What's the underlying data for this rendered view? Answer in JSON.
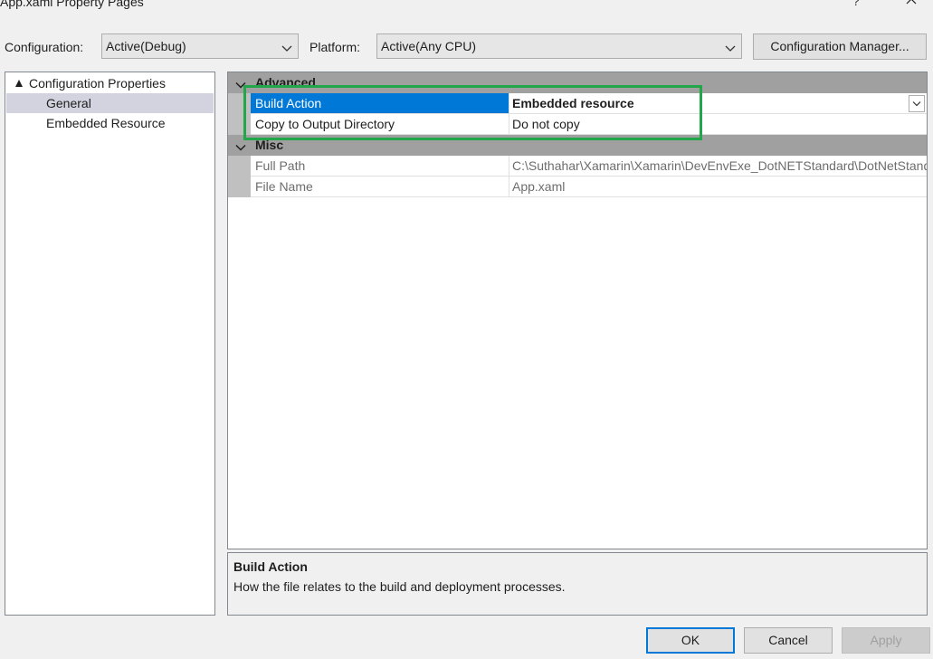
{
  "window": {
    "title": "App.xaml Property Pages",
    "help_label": "?"
  },
  "toolbar": {
    "configuration_label": "Configuration:",
    "configuration_value": "Active(Debug)",
    "platform_label": "Platform:",
    "platform_value": "Active(Any CPU)",
    "config_manager_label": "Configuration Manager..."
  },
  "tree": {
    "root_label": "Configuration Properties",
    "items": [
      {
        "label": "General",
        "selected": true
      },
      {
        "label": "Embedded Resource",
        "selected": false
      }
    ]
  },
  "grid": {
    "categories": [
      {
        "name": "Advanced",
        "properties": [
          {
            "name": "Build Action",
            "value": "Embedded resource"
          },
          {
            "name": "Copy to Output Directory",
            "value": "Do not copy"
          }
        ]
      },
      {
        "name": "Misc",
        "properties": [
          {
            "name": "Full Path",
            "value": "C:\\Suthahar\\Xamarin\\Xamarin\\DevEnvExe_DotNETStandard\\DotNetStandard\\App.xaml"
          },
          {
            "name": "File Name",
            "value": "App.xaml"
          }
        ]
      }
    ]
  },
  "description": {
    "title": "Build Action",
    "text": "How the file relates to the build and deployment processes."
  },
  "buttons": {
    "ok": "OK",
    "cancel": "Cancel",
    "apply": "Apply"
  },
  "colors": {
    "selection": "#0078d7",
    "highlight_box": "#21a64a",
    "category_bar": "#a0a0a0"
  }
}
